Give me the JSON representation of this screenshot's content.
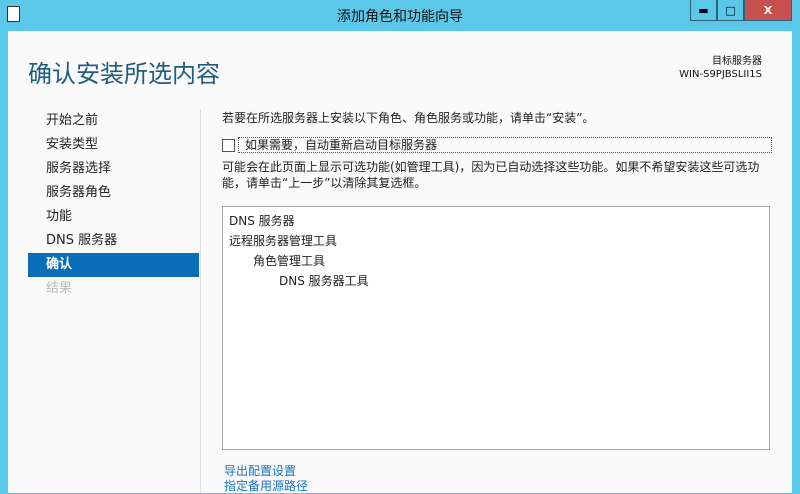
{
  "window": {
    "title": "添加角色和功能向导",
    "minimize": "▬",
    "maximize": "□",
    "close": "X"
  },
  "header": {
    "page_title": "确认安装所选内容",
    "target_label": "目标服务器",
    "target_server": "WIN-S9PJBSLII1S"
  },
  "nav": {
    "items": [
      {
        "label": "开始之前",
        "state": "normal"
      },
      {
        "label": "安装类型",
        "state": "normal"
      },
      {
        "label": "服务器选择",
        "state": "normal"
      },
      {
        "label": "服务器角色",
        "state": "normal"
      },
      {
        "label": "功能",
        "state": "normal"
      },
      {
        "label": "DNS 服务器",
        "state": "normal"
      },
      {
        "label": "确认",
        "state": "active"
      },
      {
        "label": "结果",
        "state": "disabled"
      }
    ]
  },
  "main": {
    "intro": "若要在所选服务器上安装以下角色、角色服务或功能，请单击“安装”。",
    "restart_checkbox": {
      "label": "如果需要，自动重新启动目标服务器",
      "checked": false
    },
    "note": "可能会在此页面上显示可选功能(如管理工具)，因为已自动选择这些功能。如果不希望安装这些可选功能，请单击“上一步”以清除其复选框。",
    "selections": [
      "DNS 服务器",
      "远程服务器管理工具",
      "角色管理工具",
      "DNS 服务器工具"
    ],
    "links": [
      "导出配置设置",
      "指定备用源路径"
    ]
  }
}
